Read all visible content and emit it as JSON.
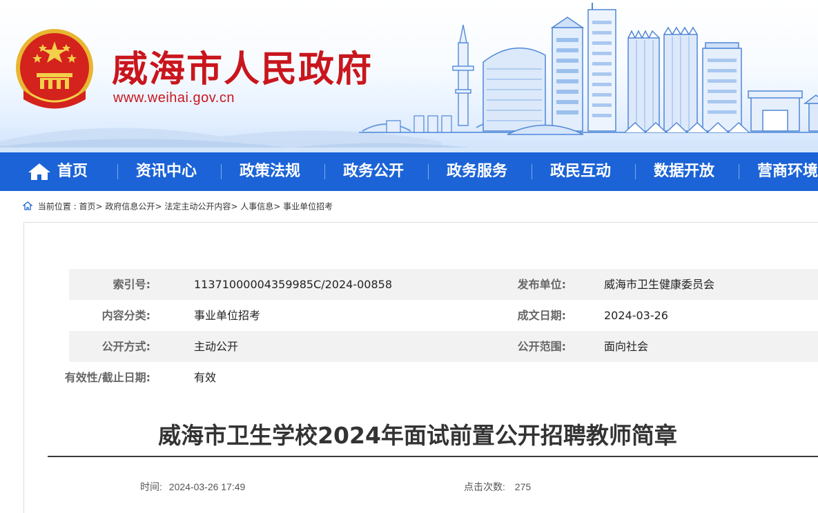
{
  "header": {
    "site_title": "威海市人民政府",
    "site_url": "www.weihai.gov.cn"
  },
  "nav": {
    "items": [
      {
        "label": "首页",
        "icon": "home-icon"
      },
      {
        "label": "资讯中心"
      },
      {
        "label": "政策法规"
      },
      {
        "label": "政务公开"
      },
      {
        "label": "政务服务"
      },
      {
        "label": "政民互动"
      },
      {
        "label": "数据开放"
      },
      {
        "label": "营商环境"
      }
    ]
  },
  "breadcrumb": {
    "prefix": "当前位置 :",
    "items": [
      "首页",
      "政府信息公开",
      "法定主动公开内容",
      "人事信息",
      "事业单位招考"
    ],
    "separator": ">"
  },
  "metadata": {
    "index_label": "索引号:",
    "index_value": "11371000004359985C/2024-00858",
    "publisher_label": "发布单位:",
    "publisher_value": "威海市卫生健康委员会",
    "category_label": "内容分类:",
    "category_value": "事业单位招考",
    "date_label": "成文日期:",
    "date_value": "2024-03-26",
    "method_label": "公开方式:",
    "method_value": "主动公开",
    "scope_label": "公开范围:",
    "scope_value": "面向社会",
    "validity_label": "有效性/截止日期:",
    "validity_value": "有效"
  },
  "article": {
    "title": "威海市卫生学校2024年面试前置公开招聘教师简章",
    "time_label": "时间:",
    "time_value": "2024-03-26 17:49",
    "views_label": "点击次数:",
    "views_value": "275"
  },
  "colors": {
    "brand_red": "#c9161d",
    "nav_blue": "#1b63d7"
  }
}
